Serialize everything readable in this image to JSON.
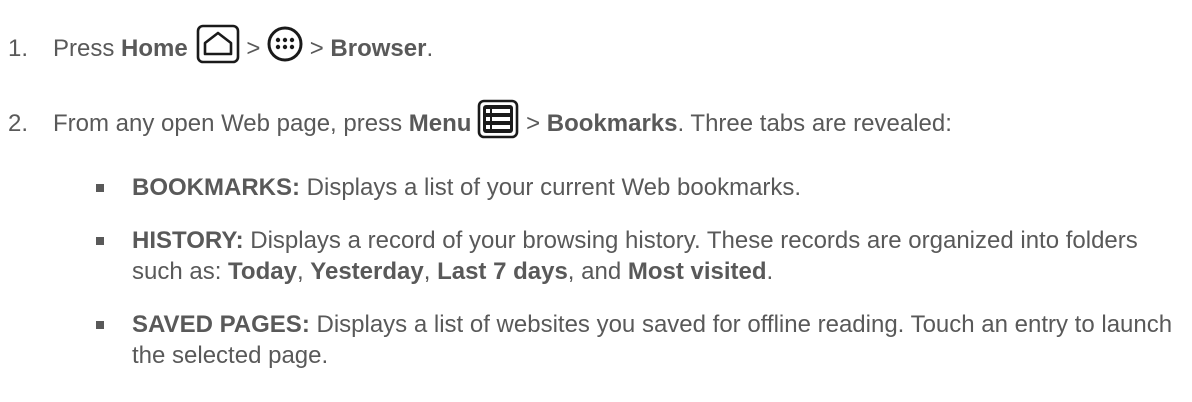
{
  "steps": [
    {
      "num": "1.",
      "t1": "Press ",
      "b1": "Home",
      "icon1": "home-key-icon",
      "s1": " > ",
      "icon2": "apps-icon",
      "s2": " > ",
      "b2": "Browser",
      "end": "."
    },
    {
      "num": "2.",
      "t1": "From any open Web page, press ",
      "b1": "Menu",
      "icon1": "menu-key-icon",
      "s1": " > ",
      "b2": "Bookmarks",
      "end": ". Three tabs are revealed:"
    }
  ],
  "bullets": [
    {
      "label": "BOOKMARKS:",
      "text": " Displays a list of your current Web bookmarks."
    },
    {
      "label": "HISTORY:",
      "text1": " Displays a record of your browsing history. These records are organized into folders such as: ",
      "f1": "Today",
      "c1": ", ",
      "f2": "Yesterday",
      "c2": ", ",
      "f3": "Last 7 days",
      "c3": ", and ",
      "f4": "Most visited",
      "end": "."
    },
    {
      "label": "SAVED PAGES:",
      "text": " Displays a list of websites you saved for offline reading. Touch an entry to launch the selected page."
    }
  ],
  "colors": {
    "text": "#595959",
    "icon": "#1a1a1a"
  }
}
